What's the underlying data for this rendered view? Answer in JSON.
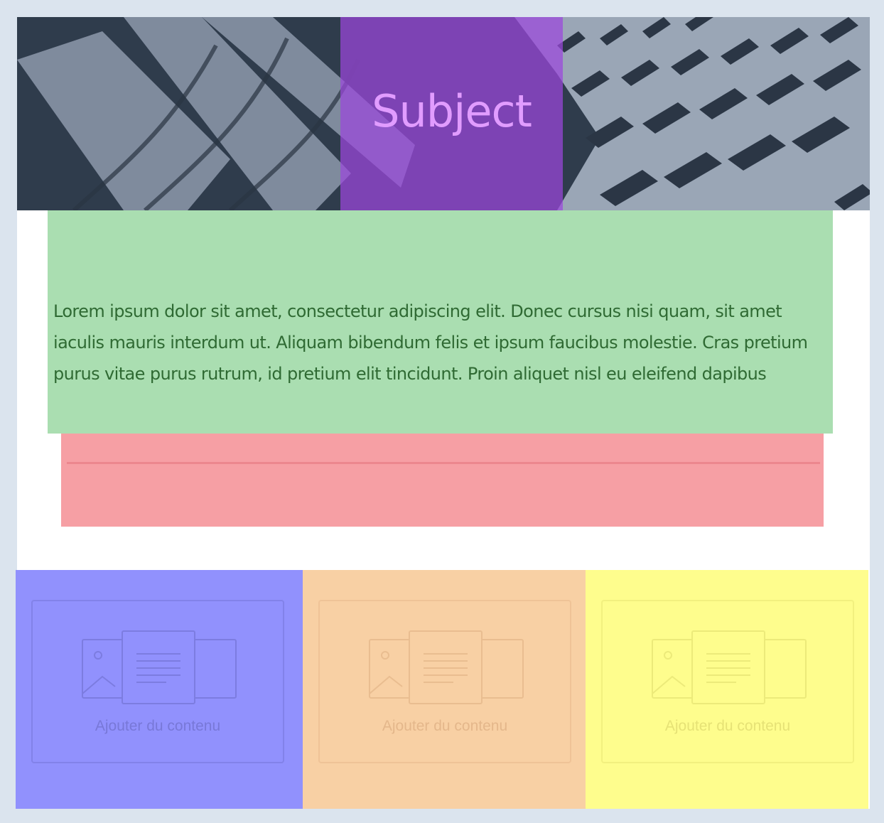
{
  "header": {
    "title": "Subject"
  },
  "body_text": "Lorem ipsum dolor sit amet, consectetur adipiscing elit. Donec cursus nisi quam, sit amet iaculis mauris interdum ut. Aliquam bibendum felis et ipsum faucibus molestie. Cras pretium purus vitae purus rutrum, id pretium elit tincidunt. Proin aliquet nisl eu eleifend dapibus",
  "columns": [
    {
      "label": "Ajouter du contenu",
      "color": "#9191fd",
      "icon": "add-content-icon"
    },
    {
      "label": "Ajouter du contenu",
      "color": "#f8d0a4",
      "icon": "add-content-icon"
    },
    {
      "label": "Ajouter du contenu",
      "color": "#fefd8d",
      "icon": "add-content-icon"
    }
  ],
  "colors": {
    "page_bg": "#dbe4ee",
    "subject_block": "#9b46dc",
    "text_block": "#aadeb1",
    "divider_block": "#f69fa4"
  }
}
